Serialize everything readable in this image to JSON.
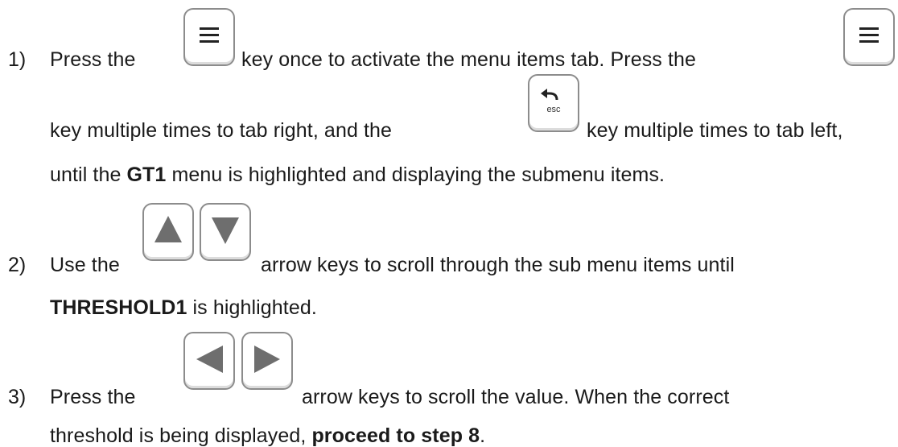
{
  "steps": [
    {
      "number": "1)",
      "line1_a": "Press the",
      "line1_b": "key once to activate the menu items tab.  Press the",
      "line2_a": "key multiple times to tab right, and the",
      "line2_b": "key multiple times to tab left,",
      "line3_a": "until the ",
      "line3_bold": "GT1",
      "line3_b": " menu is highlighted and displaying the submenu items."
    },
    {
      "number": "2)",
      "line1_a": "Use the",
      "line1_b": "arrow keys to scroll through the sub menu items until",
      "line2_bold": "THRESHOLD1",
      "line2_b": " is highlighted."
    },
    {
      "number": "3)",
      "line1_a": "Press the",
      "line1_b": "arrow keys to scroll the value.  When the correct",
      "line2_a": "threshold is being displayed, ",
      "line2_bold": "proceed to step 8",
      "line2_c": "."
    }
  ],
  "keys": {
    "esc_label": "esc",
    "icons": [
      "menu-key",
      "menu-key",
      "esc-key",
      "up-arrow-key",
      "down-arrow-key",
      "left-arrow-key",
      "right-arrow-key"
    ]
  }
}
